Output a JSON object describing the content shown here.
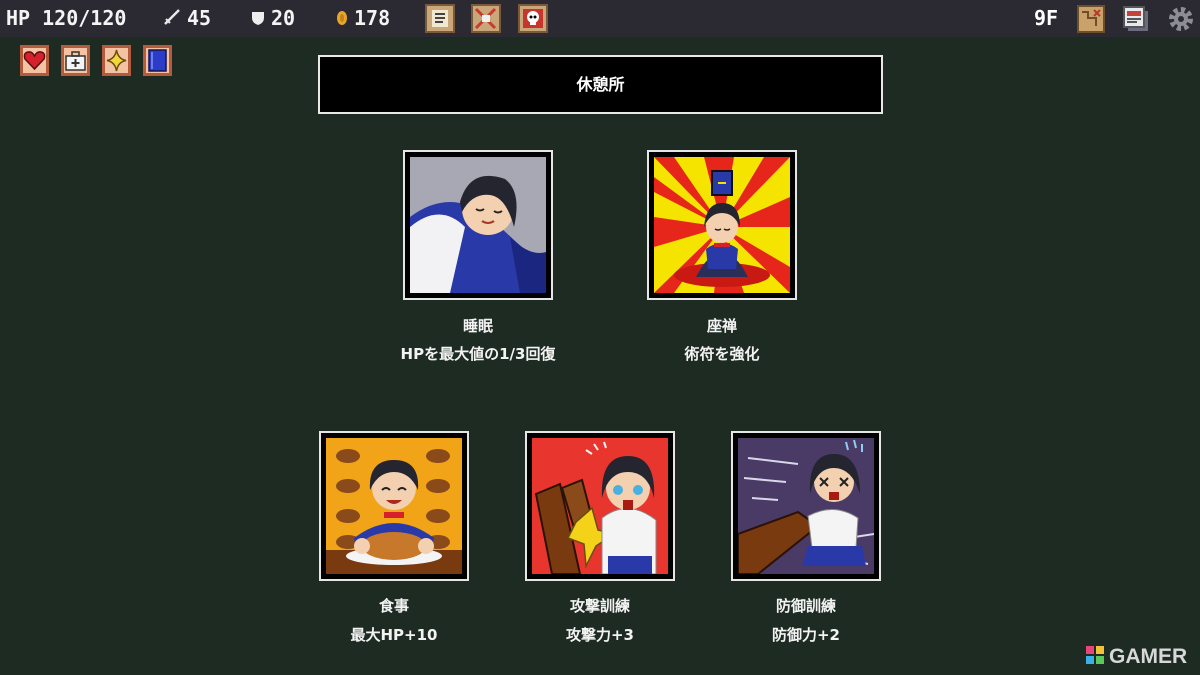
{
  "status": {
    "hp": "HP 120/120",
    "attack": "45",
    "defense": "20",
    "gold": "178",
    "floor": "9F"
  },
  "relics": [
    "scroll-icon",
    "crossed-spears-icon",
    "skull-icon"
  ],
  "items": [
    "heart-icon",
    "medkit-icon",
    "sparkle-icon",
    "blue-book-icon"
  ],
  "title": "休憩所",
  "options": [
    {
      "name": "睡眠",
      "desc": "HPを最大値の1/3回復"
    },
    {
      "name": "座禅",
      "desc": "術符を強化"
    },
    {
      "name": "食事",
      "desc": "最大HP+10"
    },
    {
      "name": "攻撃訓練",
      "desc": "攻撃力+3"
    },
    {
      "name": "防御訓練",
      "desc": "防御力+2"
    }
  ],
  "watermark": "GAMER",
  "colors": {
    "background": "#1d2b22",
    "topbar": "#2b2a33",
    "item_slot_border": "#b45b3d"
  }
}
